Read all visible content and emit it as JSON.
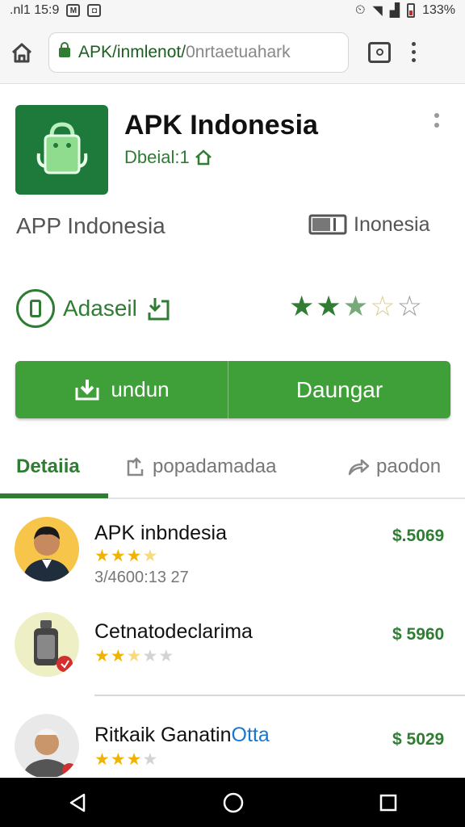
{
  "status_bar": {
    "left_text": ".nl1 15:9",
    "right_text": "133%",
    "colors": {
      "background": "#f6f6f6"
    }
  },
  "browser": {
    "url_host": "APK/inmlenot/",
    "url_path": "0nrtaetuahark",
    "icons": [
      "home-icon",
      "lock-icon",
      "tabs-icon",
      "more-vert-icon"
    ]
  },
  "app": {
    "title": "APK Indonesia",
    "subtitle": "Dbeial:1",
    "developer": "APP Indonesia",
    "region": "Inonesia",
    "badge_label": "Adaseil",
    "rating": 2.5,
    "colors": {
      "brand": "#2e7d32",
      "icon_bg": "#1d7a3b",
      "button": "#3f9f39"
    }
  },
  "actions": {
    "install_label": "undun",
    "download_label": "Daungar"
  },
  "tabs": [
    {
      "label": "Detaiia",
      "active": true,
      "icon": ""
    },
    {
      "label": "popadamadaa",
      "active": false,
      "icon": "share-box-icon"
    },
    {
      "label": "paodon",
      "active": false,
      "icon": "share-arrow-icon"
    }
  ],
  "list": [
    {
      "name": "APK inbndesia",
      "rating": 3.5,
      "meta": "3/4600:13 27",
      "price": "$.5069"
    },
    {
      "name": "Cetnatodeclarima",
      "rating": 2.5,
      "meta": "",
      "price": "$ 5960"
    },
    {
      "name": "Ritkaik Ganatin",
      "name_highlight": "Otta",
      "rating": 3,
      "meta": "",
      "price": "$ 5029"
    }
  ],
  "nav": {
    "icons": [
      "back-icon",
      "home-circle-icon",
      "recents-icon"
    ]
  }
}
